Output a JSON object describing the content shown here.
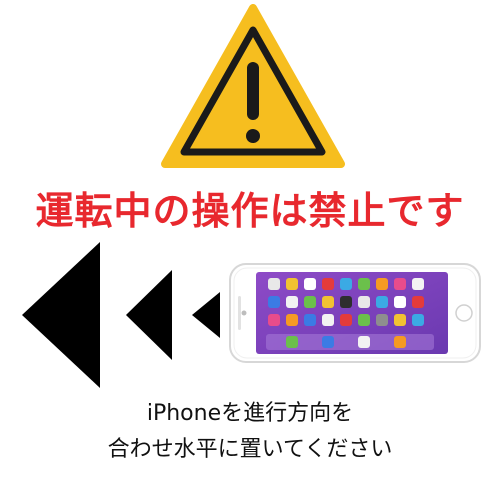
{
  "warning": {
    "icon": "warning-triangle-icon",
    "color": "#F6BE1F",
    "border": "#1A1A1A"
  },
  "headline": {
    "text": "運転中の操作は禁止です",
    "color": "#E8282E"
  },
  "arrows": {
    "icon": "rewind-arrows-icon",
    "color": "#000000"
  },
  "phone": {
    "icon": "smartphone-landscape-icon",
    "body_color": "#FFFFFF",
    "screen_color": "#7B3DB8"
  },
  "instructions": {
    "line1": "iPhoneを進行方向を",
    "line2": "合わせ水平に置いてください"
  }
}
